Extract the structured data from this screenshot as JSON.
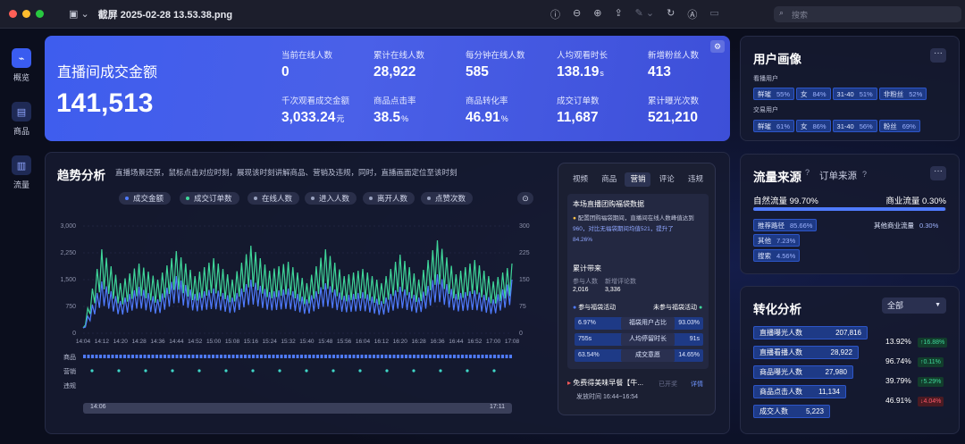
{
  "window": {
    "title": "截屏 2025-02-28 13.53.38.png",
    "search_placeholder": "搜索"
  },
  "sidebar": {
    "items": [
      {
        "label": "概览"
      },
      {
        "label": "商品"
      },
      {
        "label": "流量"
      }
    ]
  },
  "hero": {
    "title": "直播间成交金额",
    "value": "141,513",
    "metrics": [
      {
        "label": "当前在线人数",
        "value": "0",
        "unit": ""
      },
      {
        "label": "累计在线人数",
        "value": "28,922",
        "unit": ""
      },
      {
        "label": "每分钟在线人数",
        "value": "585",
        "unit": ""
      },
      {
        "label": "人均观看时长",
        "value": "138.19",
        "unit": "s"
      },
      {
        "label": "新增粉丝人数",
        "value": "413",
        "unit": ""
      },
      {
        "label": "千次观看成交金额",
        "value": "3,033.24",
        "unit": "元"
      },
      {
        "label": "商品点击率",
        "value": "38.5",
        "unit": "%"
      },
      {
        "label": "商品转化率",
        "value": "46.91",
        "unit": "%"
      },
      {
        "label": "成交订单数",
        "value": "11,687",
        "unit": ""
      },
      {
        "label": "累计曝光次数",
        "value": "521,210",
        "unit": ""
      }
    ]
  },
  "profile": {
    "title": "用户画像",
    "more": "···",
    "viewers_label": "看播用户",
    "viewers_tags": [
      {
        "name": "鲜璀",
        "pct": "55%"
      },
      {
        "name": "女",
        "pct": "84%"
      },
      {
        "name": "31-40",
        "pct": "51%"
      },
      {
        "name": "非粉丝",
        "pct": "52%"
      }
    ],
    "buyers_label": "交易用户",
    "buyers_tags": [
      {
        "name": "鲜璀",
        "pct": "61%"
      },
      {
        "name": "女",
        "pct": "86%"
      },
      {
        "name": "31-40",
        "pct": "56%"
      },
      {
        "name": "粉丝",
        "pct": "69%"
      }
    ]
  },
  "trend": {
    "title": "趋势分析",
    "desc": "直播场景还原，鼠标点击对应时刻，展现该时刻讲解商品、营销及违规，同时，直播画面定位至该时刻",
    "legend": [
      {
        "label": "成交金额",
        "color": "#4f7bff"
      },
      {
        "label": "成交订单数",
        "color": "#3fd79a"
      },
      {
        "label": "在线人数",
        "color": "#9aa3c0"
      },
      {
        "label": "进入人数",
        "color": "#9aa3c0"
      },
      {
        "label": "离开人数",
        "color": "#9aa3c0"
      },
      {
        "label": "点赞次数",
        "color": "#9aa3c0"
      }
    ],
    "rows": [
      "商品",
      "营销",
      "违规"
    ],
    "slider_start": "14:06",
    "slider_end": "17:11"
  },
  "chart_data": {
    "type": "line",
    "x": [
      "14:04",
      "14:12",
      "14:20",
      "14:28",
      "14:36",
      "14:44",
      "14:52",
      "15:00",
      "15:08",
      "15:16",
      "15:24",
      "15:32",
      "15:40",
      "15:48",
      "15:56",
      "16:04",
      "16:12",
      "16:20",
      "16:28",
      "16:36",
      "16:44",
      "16:52",
      "17:00",
      "17:08"
    ],
    "y_left_ticks": [
      "3,000",
      "2,250",
      "1,500",
      "750",
      "0"
    ],
    "y_right_ticks": [
      "300",
      "225",
      "150",
      "75",
      "0"
    ],
    "ylim_left": [
      0,
      3000
    ],
    "ylim_right": [
      0,
      300
    ],
    "series": [
      {
        "name": "成交金额",
        "axis": "left",
        "color": "#4f7bff",
        "values": [
          150,
          1450,
          900,
          1300,
          950,
          1600,
          1100,
          1250,
          1000,
          1500,
          1150,
          1250,
          950,
          1400,
          1050,
          1150,
          900,
          1300,
          1000,
          1650,
          1100,
          1200,
          950,
          1500
        ]
      },
      {
        "name": "成交订单数",
        "axis": "right",
        "color": "#3fd79a",
        "values": [
          15,
          235,
          140,
          195,
          150,
          230,
          160,
          210,
          150,
          245,
          175,
          200,
          140,
          235,
          160,
          180,
          140,
          220,
          150,
          260,
          165,
          205,
          145,
          195
        ]
      }
    ],
    "grid": true
  },
  "side_panel": {
    "tabs": [
      "视频",
      "商品",
      "营销",
      "评论",
      "违规"
    ],
    "active_tab": 2,
    "section_title": "本场直播团购福袋数据",
    "note_lines": [
      "配置团购福袋期间，直播间在线人数峰值达到",
      "960，对比无福袋期间均值521，提升了",
      "84.26%"
    ],
    "cumulative_label": "累计带来",
    "col1_label": "参与人数",
    "col1_value": "2,016",
    "col2_label": "新增评论数",
    "col2_value": "3,336",
    "legend_a": "参与福袋活动",
    "legend_b": "未参与福袋活动",
    "compare_rows": [
      {
        "left": "6.97%",
        "label": "福袋用户占比",
        "right": "93.03%"
      },
      {
        "left": "755s",
        "label": "人均停留时长",
        "right": "91s"
      },
      {
        "left": "63.54%",
        "label": "成交意愿",
        "right": "14.65%"
      }
    ],
    "event_title": "免费得美味早餐【牛...",
    "event_status": "已开奖",
    "event_link": "详情",
    "event_time": "发放时间 16:44~16:54"
  },
  "traffic": {
    "title": "流量来源",
    "alt_title": "订单来源",
    "more": "···",
    "natural": "自然流量 99.70%",
    "commercial": "商业流量 0.30%",
    "natural_share": 0.997,
    "sources": [
      {
        "name": "推荐路径",
        "pct": "85.66%"
      },
      {
        "name": "其他",
        "pct": "7.23%"
      },
      {
        "name": "搜索",
        "pct": "4.56%"
      }
    ],
    "other_commercial": {
      "name": "其他商业流量",
      "pct": "0.30%"
    }
  },
  "conversion": {
    "title": "转化分析",
    "select_value": "全部",
    "rows": [
      {
        "label": "直播曝光人数",
        "value": "207,816"
      },
      {
        "label": "直播看播人数",
        "value": "28,922"
      },
      {
        "label": "商品曝光人数",
        "value": "27,980"
      },
      {
        "label": "商品点击人数",
        "value": "11,134"
      },
      {
        "label": "成交人数",
        "value": "5,223"
      }
    ],
    "rates": [
      {
        "pct": "13.92%",
        "delta": "↑16.88%",
        "up": true
      },
      {
        "pct": "96.74%",
        "delta": "↑0.11%",
        "up": true
      },
      {
        "pct": "39.79%",
        "delta": "↑5.29%",
        "up": true
      },
      {
        "pct": "46.91%",
        "delta": "↓4.04%",
        "up": false
      }
    ]
  }
}
